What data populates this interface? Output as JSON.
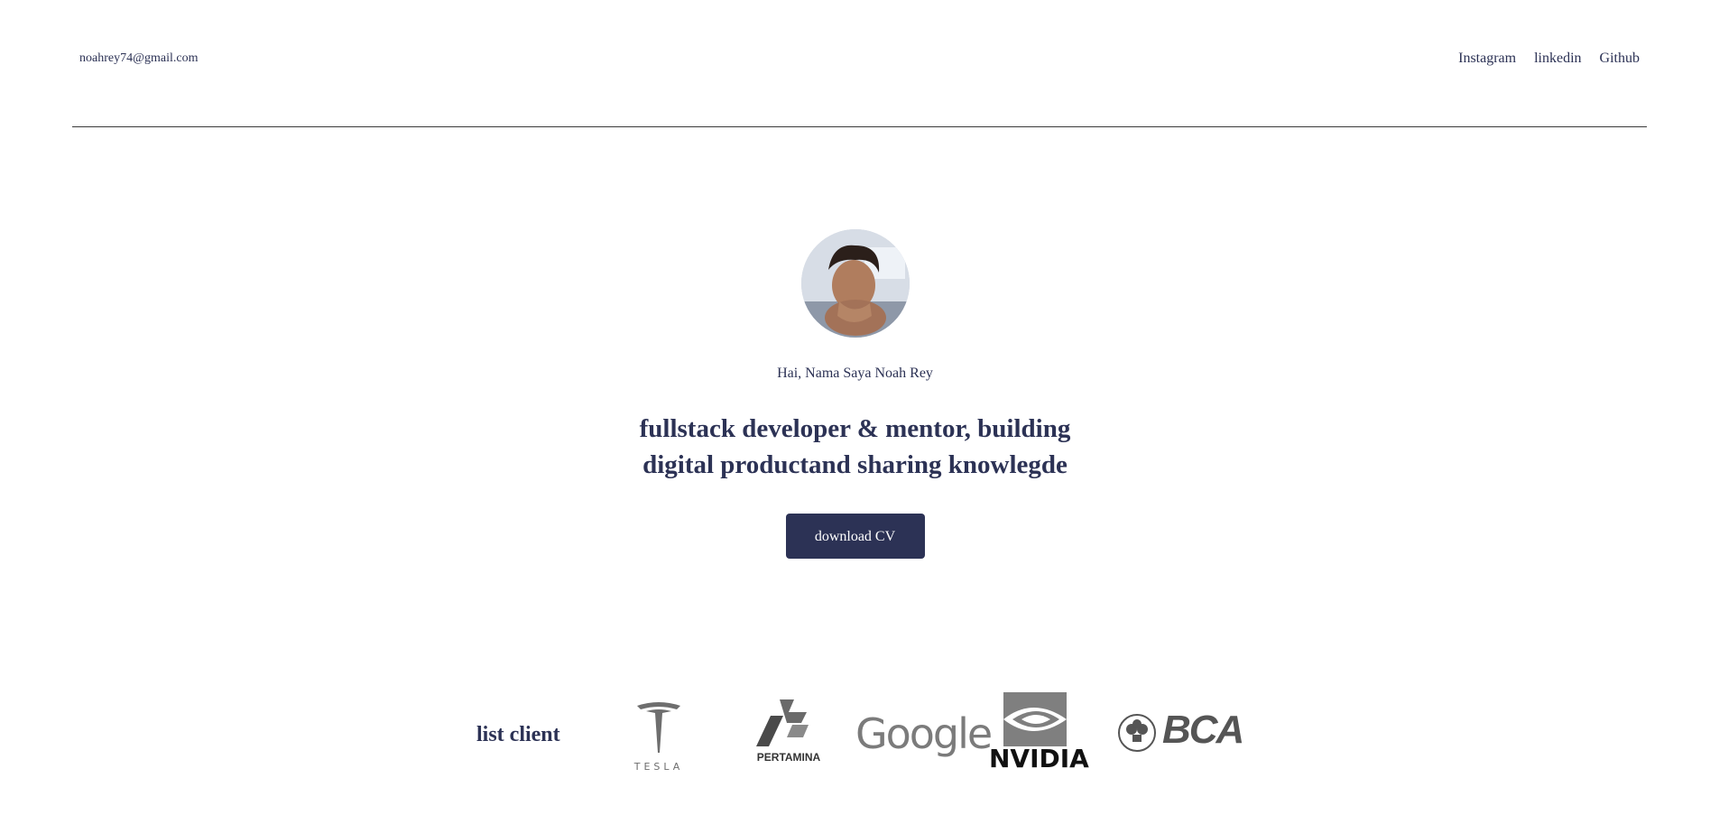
{
  "header": {
    "email": "noahrey74@gmail.com",
    "nav": [
      "Instagram",
      "linkedin",
      "Github"
    ]
  },
  "hero": {
    "greeting": "Hai, Nama Saya Noah Rey",
    "headline_line1": "fullstack developer & mentor, building",
    "headline_line2": "digital productand sharing knowlegde",
    "cta_label": "download CV"
  },
  "clients": {
    "title": "list client",
    "logos": [
      {
        "name": "tesla-logo",
        "text": "TESLA"
      },
      {
        "name": "pertamina-logo",
        "text": "PERTAMINA"
      },
      {
        "name": "google-logo",
        "text": "Google"
      },
      {
        "name": "nvidia-logo",
        "text": "NVIDIA"
      },
      {
        "name": "bca-logo",
        "text": "BCA"
      }
    ]
  },
  "colors": {
    "primary": "#2c3255",
    "divider": "#3a3a3a",
    "logo_gray": "#777777"
  }
}
